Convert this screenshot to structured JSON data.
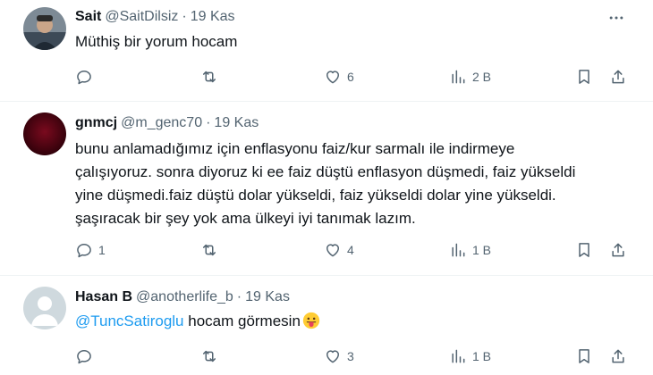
{
  "tweets": [
    {
      "name": "Sait",
      "handle": "@SaitDilsiz",
      "date": "19 Kas",
      "text": "Müthiş bir yorum hocam",
      "replies": "",
      "retweets": "",
      "likes": "6",
      "views": "2 B"
    },
    {
      "name": "gnmcj",
      "handle": "@m_genc70",
      "date": "19 Kas",
      "lines": [
        "bunu anlamadığımız için enflasyonu faiz/kur sarmalı ile indirmeye",
        "çalışıyoruz. sonra diyoruz ki ee faiz düştü enflasyon düşmedi, faiz yükseldi",
        "yine düşmedi.faiz düştü dolar yükseldi, faiz yükseldi dolar yine yükseldi.",
        "şaşıracak bir şey yok ama ülkeyi iyi tanımak lazım."
      ],
      "replies": "1",
      "retweets": "",
      "likes": "4",
      "views": "1 B"
    },
    {
      "name": "Hasan B",
      "handle": "@anotherlife_b",
      "date": "19 Kas",
      "mention": "@TuncSatiroglu",
      "text": " hocam görmesin",
      "replies": "",
      "retweets": "",
      "likes": "3",
      "views": "1 B"
    }
  ],
  "separator": "·",
  "icons": [
    "more-icon",
    "reply-icon",
    "retweet-icon",
    "like-icon",
    "views-icon",
    "bookmark-icon",
    "share-icon",
    "tongue-emoji"
  ],
  "colors": {
    "text": "#0f1419",
    "secondary": "#536471",
    "link": "#1d9bf0",
    "divider": "#eff3f4"
  }
}
